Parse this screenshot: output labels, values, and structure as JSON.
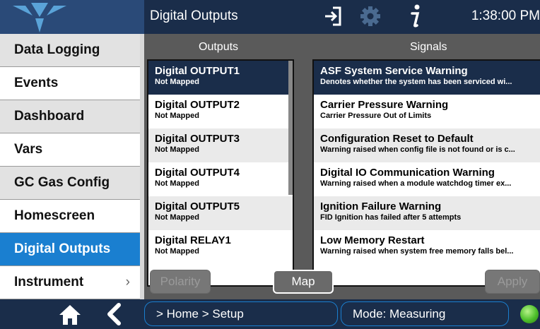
{
  "header": {
    "title": "Digital Outputs",
    "time": "1:38:00 PM",
    "icons": [
      "logo",
      "exit-icon",
      "gear-icon",
      "info-icon"
    ]
  },
  "sidebar": {
    "items": [
      {
        "label": "Data Logging"
      },
      {
        "label": "Events"
      },
      {
        "label": "Dashboard"
      },
      {
        "label": "Vars"
      },
      {
        "label": "GC Gas Config"
      },
      {
        "label": "Homescreen"
      },
      {
        "label": "Digital Outputs"
      },
      {
        "label": "Instrument",
        "chevron": "›"
      }
    ],
    "active": "Digital Outputs"
  },
  "outputs": {
    "header": "Outputs",
    "rows": [
      {
        "name": "Digital OUTPUT1",
        "status": "Not Mapped"
      },
      {
        "name": "Digital OUTPUT2",
        "status": "Not Mapped"
      },
      {
        "name": "Digital OUTPUT3",
        "status": "Not Mapped"
      },
      {
        "name": "Digital OUTPUT4",
        "status": "Not Mapped"
      },
      {
        "name": "Digital OUTPUT5",
        "status": "Not Mapped"
      },
      {
        "name": "Digital RELAY1",
        "status": "Not Mapped"
      }
    ]
  },
  "signals": {
    "header": "Signals",
    "rows": [
      {
        "name": "ASF System Service Warning",
        "desc": "Denotes whether the system has been serviced wi..."
      },
      {
        "name": "Carrier Pressure Warning",
        "desc": "Carrier Pressure Out of Limits"
      },
      {
        "name": "Configuration Reset to Default",
        "desc": "Warning raised when config file is not found or is c..."
      },
      {
        "name": "Digital IO Communication Warning",
        "desc": "Warning raised when a module watchdog timer ex..."
      },
      {
        "name": "Ignition Failure Warning",
        "desc": "FID Ignition has failed after 5 attempts"
      },
      {
        "name": "Low Memory Restart",
        "desc": "Warning raised when system free memory falls bel..."
      }
    ]
  },
  "buttons": {
    "polarity": "Polarity",
    "map": "Map",
    "apply": "Apply"
  },
  "footer": {
    "breadcrumb": "> Home > Setup",
    "mode": "Mode: Measuring"
  },
  "colors": {
    "accent": "#1a7fd0",
    "dark": "#1a2d4a",
    "status_led": "#4cbf2a"
  }
}
